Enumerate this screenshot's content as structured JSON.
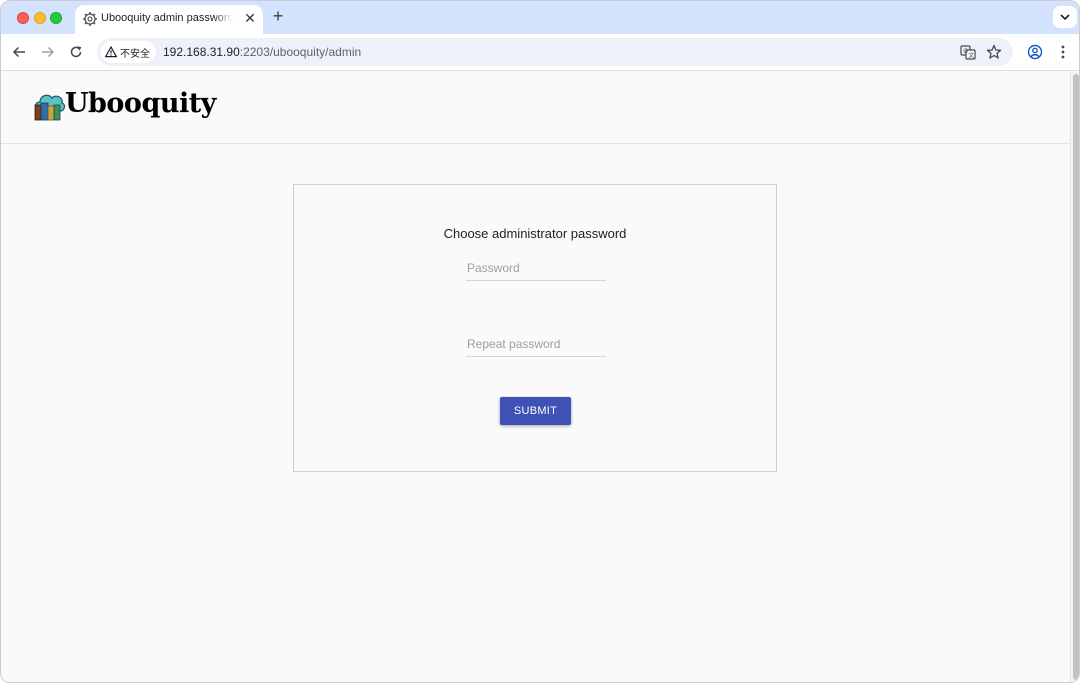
{
  "browser": {
    "tab_title": "Ubooquity admin password s",
    "tab_icon": "gear-icon",
    "new_tab_label": "+",
    "security_label": "不安全",
    "url_host": "192.168.31.90",
    "url_path": ":2203/ubooquity/admin",
    "accent_color": "#d3e3fd"
  },
  "page": {
    "logo_text": "Ubooquity",
    "form": {
      "title": "Choose administrator password",
      "password_placeholder": "Password",
      "password_value": "",
      "repeat_placeholder": "Repeat password",
      "repeat_value": "",
      "submit_label": "SUBMIT",
      "submit_color": "#3f51b5"
    }
  }
}
